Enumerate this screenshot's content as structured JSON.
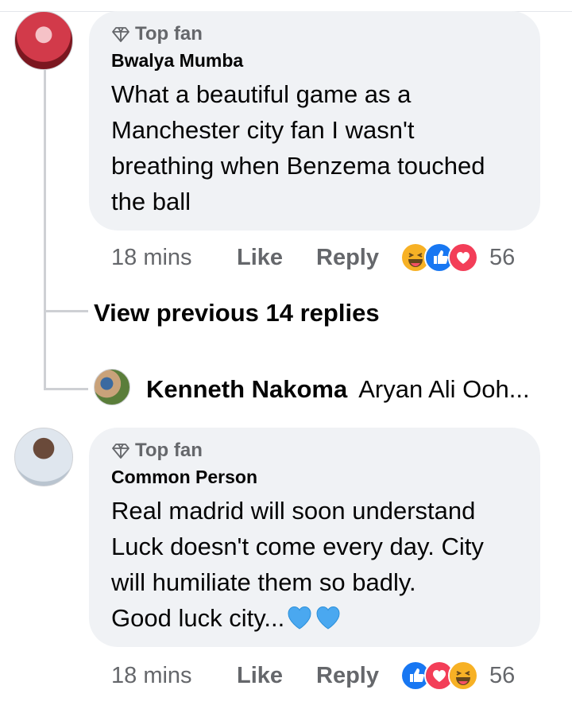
{
  "comments": [
    {
      "badge": "Top fan",
      "author": "Bwalya Mumba",
      "text": "What a beautiful game as a Manchester city fan I wasn't breathing when Benzema touched the ball",
      "time": "18 mins",
      "like_label": "Like",
      "reply_label": "Reply",
      "reactions": [
        "haha",
        "like",
        "love"
      ],
      "reaction_count": "56"
    },
    {
      "badge": "Top fan",
      "author": "Common Person",
      "text_lines": [
        "Real madrid will soon understand",
        "Luck doesn't come every day.  City",
        "will humiliate them so badly.",
        "Good luck city..."
      ],
      "text_emoji": [
        "blue-heart",
        "blue-heart"
      ],
      "time": "18 mins",
      "like_label": "Like",
      "reply_label": "Reply",
      "reactions": [
        "like",
        "love",
        "haha"
      ],
      "reaction_count": "56"
    }
  ],
  "replies": {
    "view_previous_label": "View previous 14 replies",
    "latest": {
      "author": "Kenneth Nakoma",
      "snippet": "Aryan Ali Ooh..."
    }
  },
  "colors": {
    "bubble": "#f0f2f5",
    "meta_text": "#65676b",
    "like_blue": "#1877f2",
    "love_red": "#f33e58",
    "haha_yellow": "#f7b125",
    "heart_blue": "#4aa8f0"
  }
}
